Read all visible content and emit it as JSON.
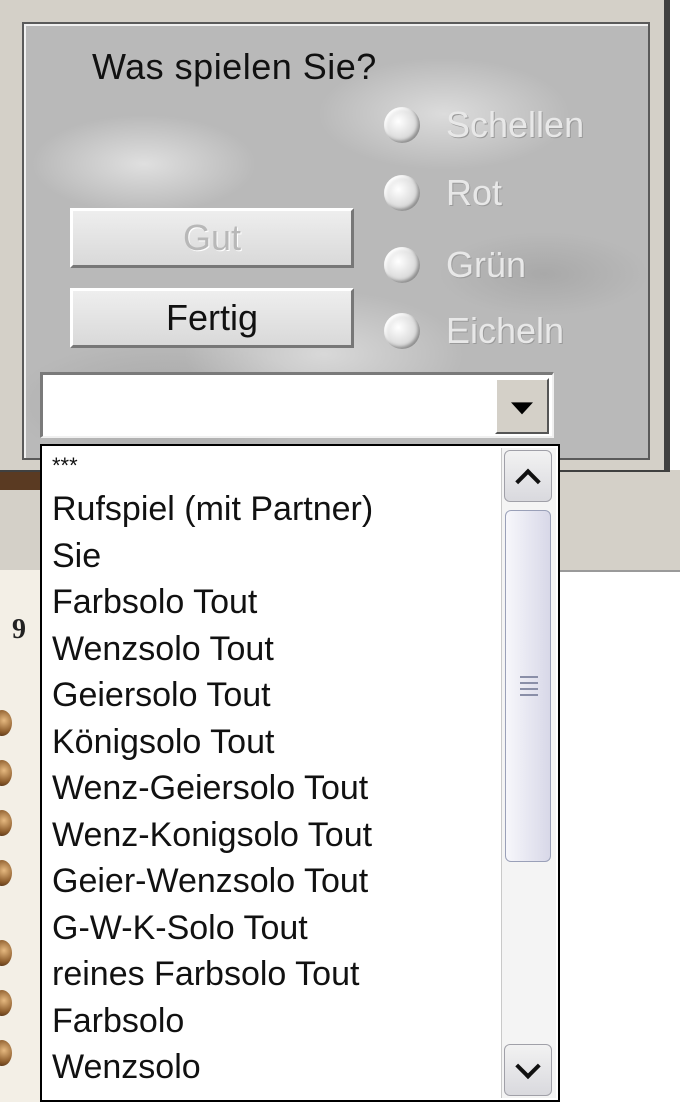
{
  "dialog": {
    "title": "Was spielen Sie?",
    "suits": [
      "Schellen",
      "Rot",
      "Grün",
      "Eicheln"
    ],
    "buttons": {
      "ok_label": "Gut",
      "done_label": "Fertig"
    },
    "combo": {
      "value": ""
    },
    "game_list": [
      "***",
      "Rufspiel (mit Partner)",
      "Sie",
      "Farbsolo Tout",
      "Wenzsolo Tout",
      "Geiersolo Tout",
      "Königsolo Tout",
      "Wenz-Geiersolo Tout",
      "Wenz-Konigsolo Tout",
      "Geier-Wenzsolo Tout",
      "G-W-K-Solo Tout",
      "reines Farbsolo Tout",
      "Farbsolo",
      "Wenzsolo"
    ]
  },
  "icons": {
    "combo_arrow": "chevron-down-icon",
    "scroll_up": "chevron-up-icon",
    "scroll_down": "chevron-down-icon"
  },
  "background": {
    "side_label": "9"
  }
}
